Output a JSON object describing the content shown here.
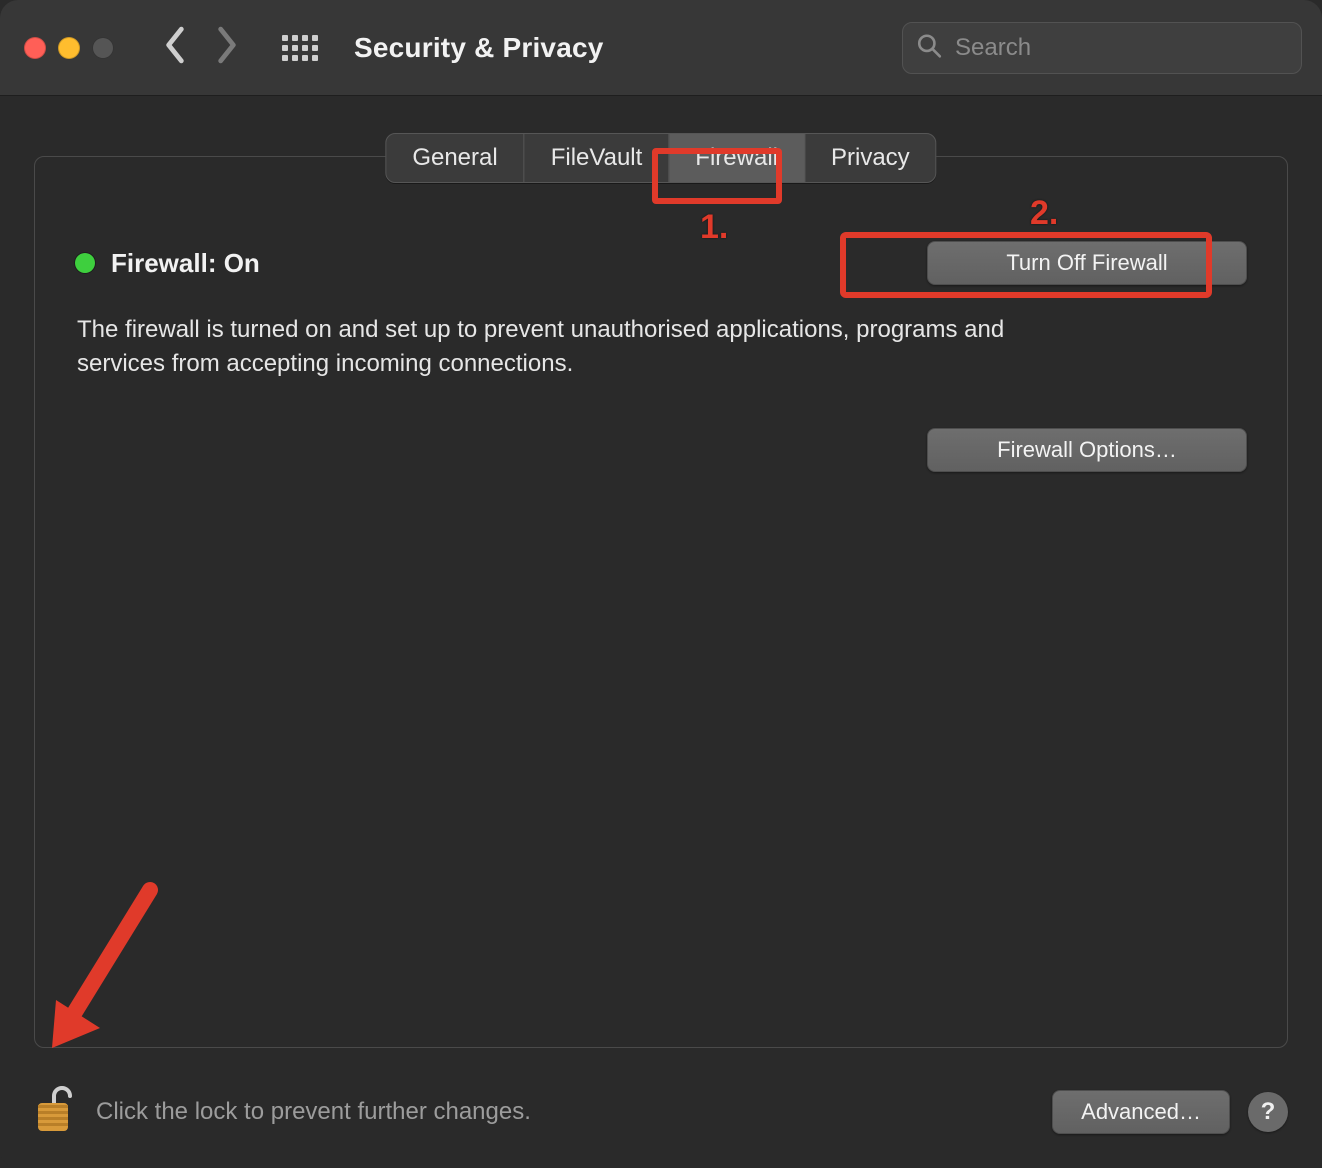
{
  "window": {
    "title": "Security & Privacy"
  },
  "search": {
    "placeholder": "Search"
  },
  "tabs": {
    "items": [
      "General",
      "FileVault",
      "Firewall",
      "Privacy"
    ],
    "active_index": 2
  },
  "firewall": {
    "status_label": "Firewall: On",
    "status_color": "#3ecf3e",
    "turn_off_label": "Turn Off Firewall",
    "description": "The firewall is turned on and set up to prevent unauthorised applications, programs and services from accepting incoming connections.",
    "options_label": "Firewall Options…"
  },
  "footer": {
    "lock_text": "Click the lock to prevent further changes.",
    "advanced_label": "Advanced…",
    "help_label": "?"
  },
  "annotations": {
    "num1": "1.",
    "num2": "2."
  },
  "colors": {
    "annotation_red": "#e03a2a",
    "traffic_red": "#ff5f57",
    "traffic_yellow": "#ffbd2e"
  }
}
